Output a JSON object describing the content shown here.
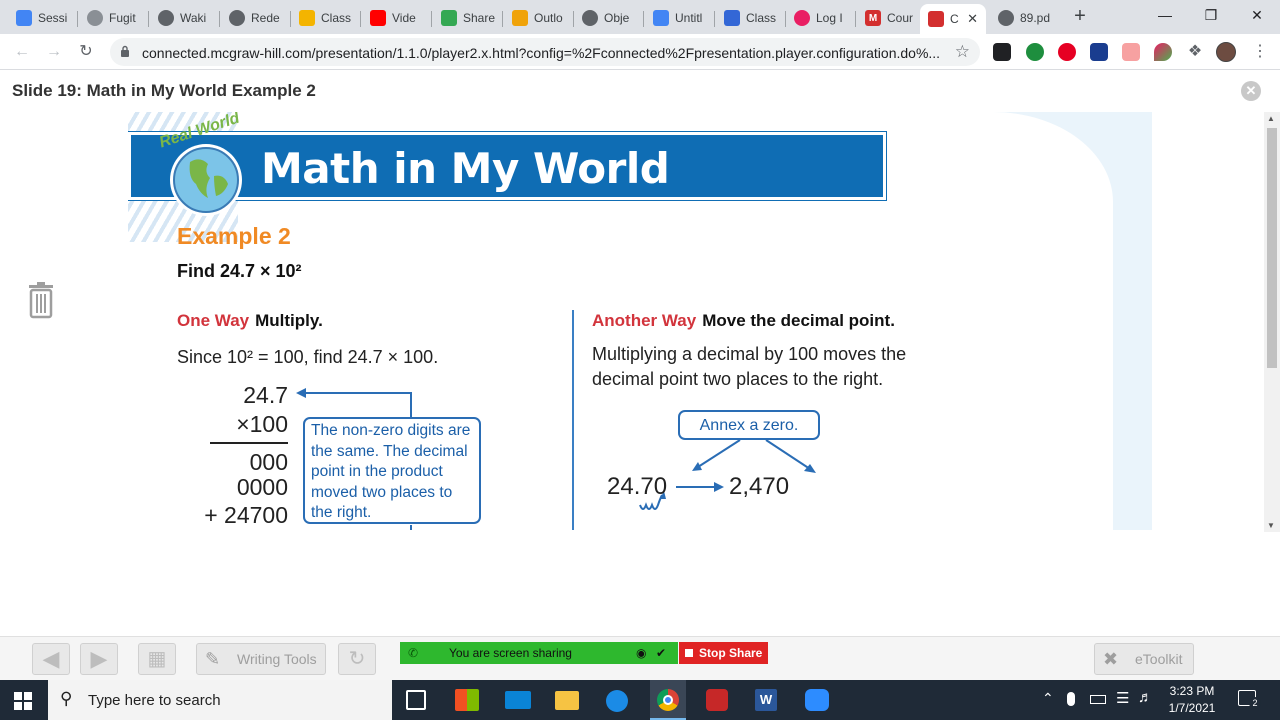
{
  "browser": {
    "tabs": [
      {
        "label": "Sessi",
        "color": "#4285f4"
      },
      {
        "label": "Fugit",
        "color": "#8a8f95"
      },
      {
        "label": "Waki",
        "color": "#5f6368"
      },
      {
        "label": "Rede",
        "color": "#5f6368"
      },
      {
        "label": "Class",
        "color": "#f4b400"
      },
      {
        "label": "Vide",
        "color": "#ff0000"
      },
      {
        "label": "Share",
        "color": "#34a853"
      },
      {
        "label": "Outlo",
        "color": "#f0a30a"
      },
      {
        "label": "Obje",
        "color": "#5f6368"
      },
      {
        "label": "Untitl",
        "color": "#4285f4"
      },
      {
        "label": "Class",
        "color": "#3367d6"
      },
      {
        "label": "Log I",
        "color": "#e91e63"
      },
      {
        "label": "Cour",
        "color": "#d32f2f"
      },
      {
        "label": "C",
        "color": "#d32f2f"
      },
      {
        "label": "89.pd",
        "color": "#5f6368"
      }
    ],
    "active_tab_close": "✕",
    "new_tab": "+",
    "url": "connected.mcgraw-hill.com/presentation/1.1.0/player2.x.html?config=%2Fconnected%2Fpresentation.player.configuration.do%..."
  },
  "player": {
    "slide_title": "Slide 19: Math in My World Example 2"
  },
  "slide": {
    "badge": "Real World",
    "banner_title": "Math in My World",
    "example_title": "Example 2",
    "find": "Find 24.7 × 10²",
    "one_way": {
      "label": "One Way",
      "action": "Multiply.",
      "since": "Since 10² = 100, find 24.7 × 100.",
      "rows": [
        "24.7",
        "×100",
        "000",
        "0000",
        "+ 24700"
      ],
      "callout": "The non-zero digits are the same. The decimal point in the product moved two places to the right."
    },
    "another_way": {
      "label": "Another Way",
      "action": "Move the decimal point.",
      "text_line1": "Multiplying a decimal by 100 moves the",
      "text_line2": "decimal point two places to the right.",
      "callout": "Annex a zero.",
      "from": "24.70",
      "to": "2,470"
    }
  },
  "bottom_bar": {
    "writing_tools": "Writing Tools",
    "etoolkit": "eToolkit",
    "sharing": "You are screen sharing",
    "stop_share": "Stop Share",
    "colors": {
      "sharing": "#2eb82e",
      "stop": "#e02424"
    }
  },
  "taskbar": {
    "search_placeholder": "Type here to search",
    "time": "3:23 PM",
    "date": "1/7/2021",
    "notifications": "2"
  }
}
